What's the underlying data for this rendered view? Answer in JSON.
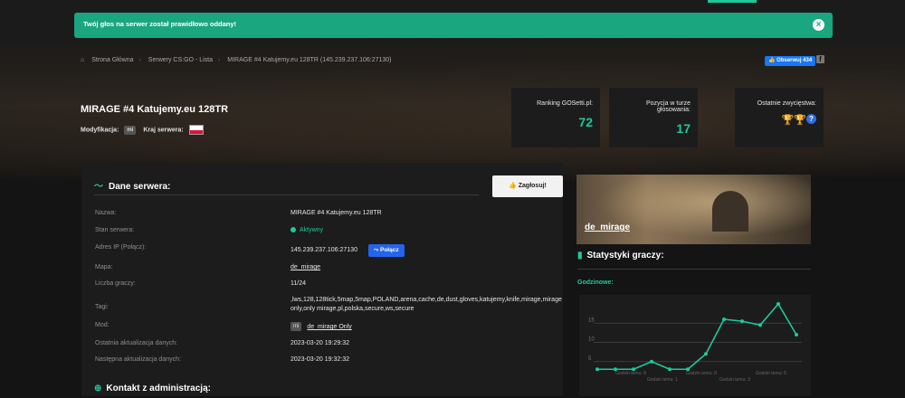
{
  "alert": {
    "message": "Twój głos na serwer został prawidłowo oddany!"
  },
  "breadcrumb": {
    "home": "Strona Główna",
    "list": "Serwery CS:GO - Lista",
    "current": "MIRAGE #4 Katujemy.eu 128TR (145.239.237.106:27130)"
  },
  "social": {
    "fb_label": "Obserwuj 434"
  },
  "server": {
    "title": "MIRAGE #4 Katujemy.eu 128TR",
    "mod_label": "Modyfikacja:",
    "mod_value": "mi",
    "country_label": "Kraj serwera:"
  },
  "stats": {
    "ranking_label": "Ranking GOSetti.pl:",
    "ranking_value": "72",
    "position_label": "Pozycja w turze głosowania:",
    "position_value": "17",
    "winners_label": "Ostatnie zwycięstwa:",
    "winners_icons": [
      "gold-trophy-icon",
      "silver-trophy-icon",
      "question-icon"
    ]
  },
  "details": {
    "heading": "Dane serwera:",
    "vote_button": "Zagłosuj!",
    "connect_button": "Połącz",
    "rows": {
      "name": {
        "label": "Nazwa:",
        "value": "MIRAGE #4 Katujemy.eu 128TR"
      },
      "status": {
        "label": "Stan serwera:",
        "value": "Aktywny"
      },
      "ip": {
        "label": "Adres IP (Połącz):",
        "value": "145.239.237.106:27130"
      },
      "map": {
        "label": "Mapa:",
        "value": "de_mirage"
      },
      "players": {
        "label": "Liczba graczy:",
        "value": "11/24"
      },
      "tags": {
        "label": "Tagi:",
        "value": ",lws,128,128tick,5map,5map,POLAND,arena,cache,de,dust,gloves,katujemy,knife,mirage,mirage only,only mirage,pl,polska,secure,ws,secure"
      },
      "mod": {
        "label": "Mod:",
        "badge": "mi",
        "value": "de_mirage Only"
      },
      "last_update": {
        "label": "Ostatnia aktualizacja danych:",
        "value": "2023-03-20 19:29:32"
      },
      "next_update": {
        "label": "Następna aktualizacja danych:",
        "value": "2023-03-20 19:32:32"
      }
    },
    "contact_heading": "Kontakt z administracją:"
  },
  "map_card": {
    "name": "de_mirage"
  },
  "player_stats": {
    "heading": "Statystyki graczy:",
    "subheading": "Godzinowe:"
  },
  "colors": {
    "accent": "#1ec99b",
    "alert": "#1aa67f",
    "connect": "#2563eb"
  },
  "chart_data": {
    "type": "line",
    "title": "",
    "xlabel": "",
    "ylabel": "",
    "ylim": [
      0,
      20
    ],
    "yticks": [
      5,
      10,
      15
    ],
    "visible_x_labels": [
      "Godzin temu: 9",
      "Godzin temu: 1",
      "Godzin temu: 8",
      "Godzin temu: 3",
      "Godzin temu: 5"
    ],
    "series": [
      {
        "name": "",
        "values": [
          3,
          3,
          3,
          5,
          3,
          3,
          7,
          16,
          15.5,
          14.5,
          20,
          12
        ]
      }
    ]
  }
}
